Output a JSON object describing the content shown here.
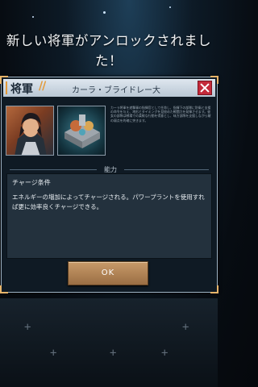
{
  "notification": {
    "line1": "新しい将軍がアンロックされまし",
    "line2": "た！"
  },
  "panel": {
    "header_label": "将軍",
    "header_slash": "//",
    "general_name": "カーラ・ブライドレー大",
    "description": "カーラ将軍を遊撃軍の指揮官として任命し、指揮下の部隊に防衛と支援の命令を与え、地形とタイミングを見極めた戦闘力を発揮させます。彼女の部隊は戦場での柔軟な行動を得意とし、味方部隊を支援しながら敵の弱点を的確に突きます。",
    "section_label": "能力",
    "ability_title": "チャージ条件",
    "ability_text": "エネルギーの増加によってチャージされる。パワープラントを使用すれば更に効率良くチャージできる。",
    "ok_label": "OK"
  },
  "icons": {
    "close": "close-icon",
    "portrait": "general-portrait",
    "unit": "unit-image"
  }
}
